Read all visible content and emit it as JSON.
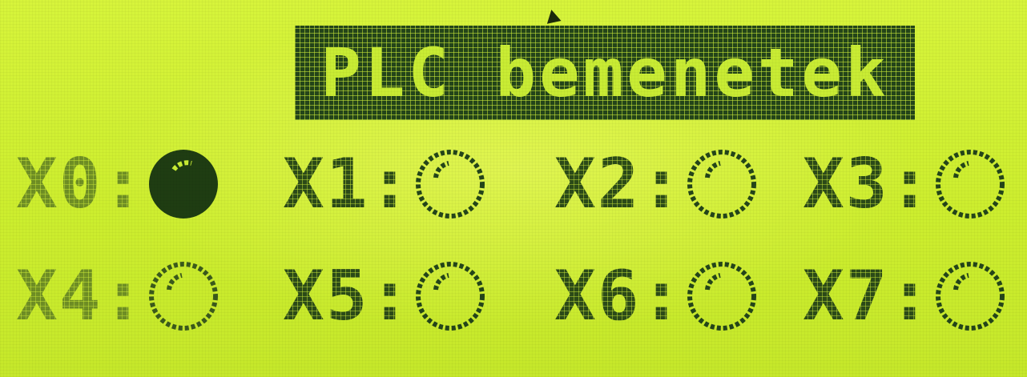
{
  "screen": {
    "title": "PLC bemenetek"
  },
  "inputs": [
    {
      "label": "X0:",
      "state": "on"
    },
    {
      "label": "X1:",
      "state": "off"
    },
    {
      "label": "X2:",
      "state": "off"
    },
    {
      "label": "X3:",
      "state": "off"
    },
    {
      "label": "X4:",
      "state": "off"
    },
    {
      "label": "X5:",
      "state": "off"
    },
    {
      "label": "X6:",
      "state": "off"
    },
    {
      "label": "X7:",
      "state": "off"
    }
  ],
  "colors": {
    "lcd_background": "#d6f23a",
    "pixel_on": "#24451a",
    "pixel_faded": "#6f8f24"
  },
  "icons": {
    "indicator_on": "filled-circle-icon",
    "indicator_off": "empty-circle-icon"
  }
}
